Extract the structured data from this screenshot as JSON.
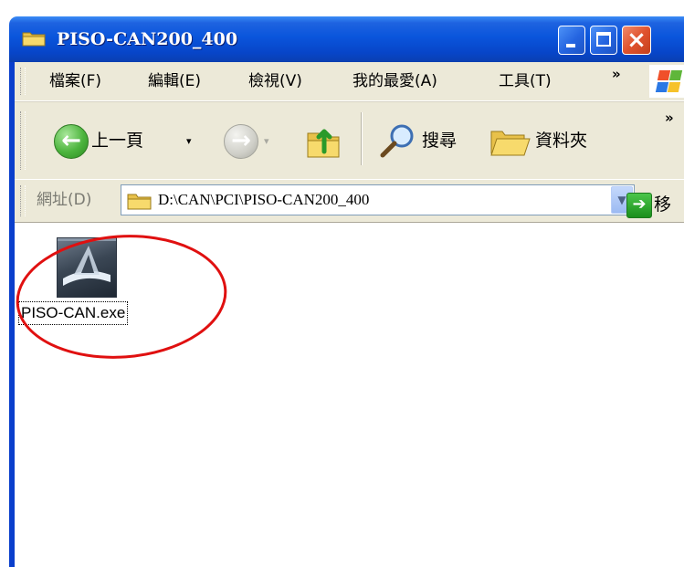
{
  "window": {
    "title": "PISO-CAN200_400"
  },
  "menu": {
    "items": [
      "檔案(F)",
      "編輯(E)",
      "檢視(V)",
      "我的最愛(A)",
      "工具(T)"
    ],
    "overflow": "»"
  },
  "toolbar": {
    "back_label": "上一頁",
    "search_label": "搜尋",
    "folders_label": "資料夾",
    "overflow": "»",
    "dropdown_glyph": "▾"
  },
  "address": {
    "label": "網址(D)",
    "path": "D:\\CAN\\PCI\\PISO-CAN200_400",
    "go_label": "移至"
  },
  "content": {
    "files": [
      {
        "name": "PISO-CAN.exe",
        "icon": "application-exe-icon",
        "selected": true
      }
    ],
    "annotation": "red-ellipse"
  },
  "colors": {
    "titlebar": "#0a55dc",
    "chrome": "#ece9d8",
    "close_button": "#e0532e",
    "annotation_red": "#e01010"
  }
}
